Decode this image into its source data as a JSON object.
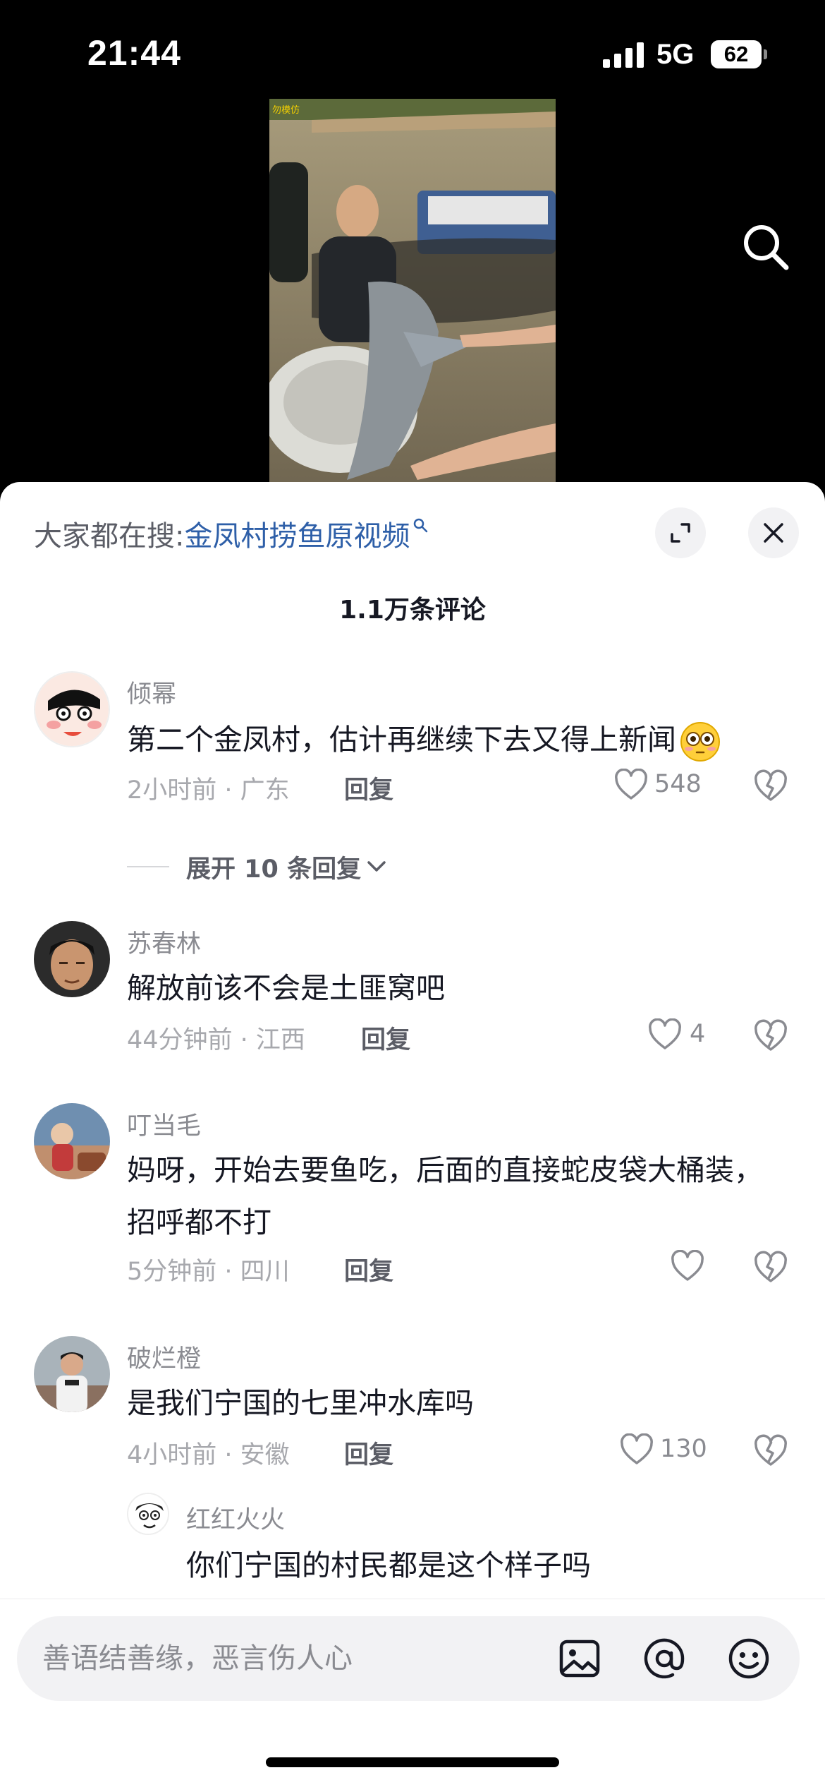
{
  "status_bar": {
    "time": "21:44",
    "network": "5G",
    "battery": "62"
  },
  "video": {
    "watermark": "勿模仿"
  },
  "sheet": {
    "hot_search_prefix": "大家都在搜:",
    "hot_search_keyword": "金凤村捞鱼原视频",
    "comment_count": "1.1万条评论"
  },
  "comments": [
    {
      "user": "倾幂",
      "text": "第二个金凤村，估计再继续下去又得上新闻",
      "meta": "2小时前 · 广东",
      "reply_label": "回复",
      "likes": "548"
    },
    {
      "user": "苏春林",
      "text": "解放前该不会是土匪窝吧",
      "meta": "44分钟前 · 江西",
      "reply_label": "回复",
      "likes": "4"
    },
    {
      "user": "叮当毛",
      "text": "妈呀，开始去要鱼吃，后面的直接蛇皮袋大桶装，招呼都不打",
      "meta": "5分钟前 · 四川",
      "reply_label": "回复",
      "likes": ""
    },
    {
      "user": "破烂橙",
      "text": "是我们宁国的七里冲水库吗",
      "meta": "4小时前 · 安徽",
      "reply_label": "回复",
      "likes": "130"
    }
  ],
  "expand_replies": "展开 10 条回复",
  "sub_reply": {
    "user": "红红火火",
    "text": "你们宁国的村民都是这个样子吗"
  },
  "input": {
    "placeholder": "善语结善缘，恶言伤人心"
  },
  "icons": [
    "signal-icon",
    "battery-icon",
    "search-icon",
    "expand-icon",
    "close-icon",
    "heart-icon",
    "dislike-heart-icon",
    "chevron-down-icon",
    "image-icon",
    "at-icon",
    "emoji-icon"
  ],
  "colors": {
    "keyword": "#2e5fa8",
    "text": "#161823",
    "meta": "#a7a8ad",
    "sheet": "#ffffff",
    "input_bg": "#f2f2f4"
  }
}
